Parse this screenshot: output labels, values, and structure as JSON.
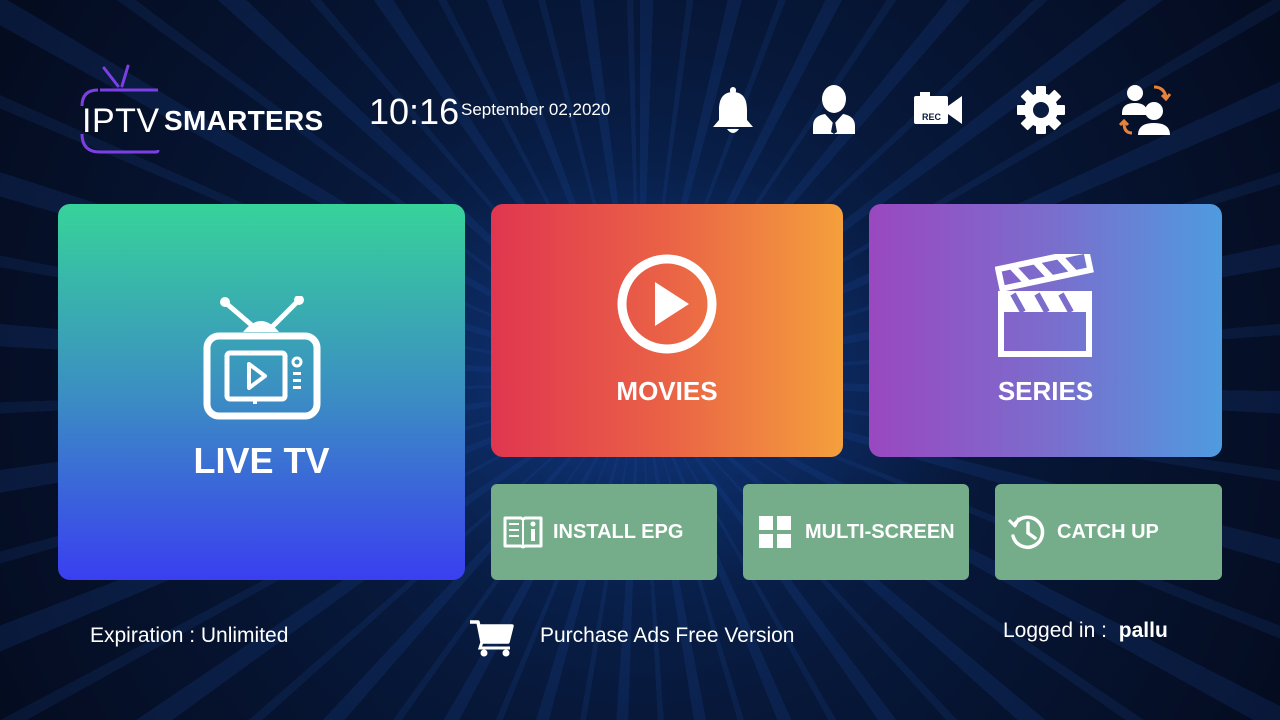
{
  "logo": {
    "prefix": "IPTV",
    "suffix": "SMARTERS"
  },
  "clock": {
    "time": "10:16",
    "date": "September 02,2020"
  },
  "header_icons": [
    "bell-icon",
    "user-profile-icon",
    "record-camera-icon",
    "gear-icon",
    "switch-user-icon"
  ],
  "record_badge": "REC",
  "tiles": {
    "live_tv": "LIVE TV",
    "movies": "MOVIES",
    "series": "SERIES",
    "install_epg": "INSTALL EPG",
    "multi_screen": "MULTI-SCREEN",
    "catch_up": "CATCH UP"
  },
  "footer": {
    "expiration": "Expiration : Unlimited",
    "purchase": "Purchase Ads Free Version",
    "logged_in_label": "Logged in :",
    "username": "pallu"
  },
  "colors": {
    "live_tv_gradient": [
      "#37d39a",
      "#3a3ff0"
    ],
    "movies_gradient": [
      "#e0364f",
      "#f4a03c"
    ],
    "series_gradient": [
      "#9a48c0",
      "#4f9be0"
    ],
    "small_tile": "#75ad8a",
    "logo_accent": "#7b3fe4",
    "catch_up_arrows": "#e8823a"
  }
}
